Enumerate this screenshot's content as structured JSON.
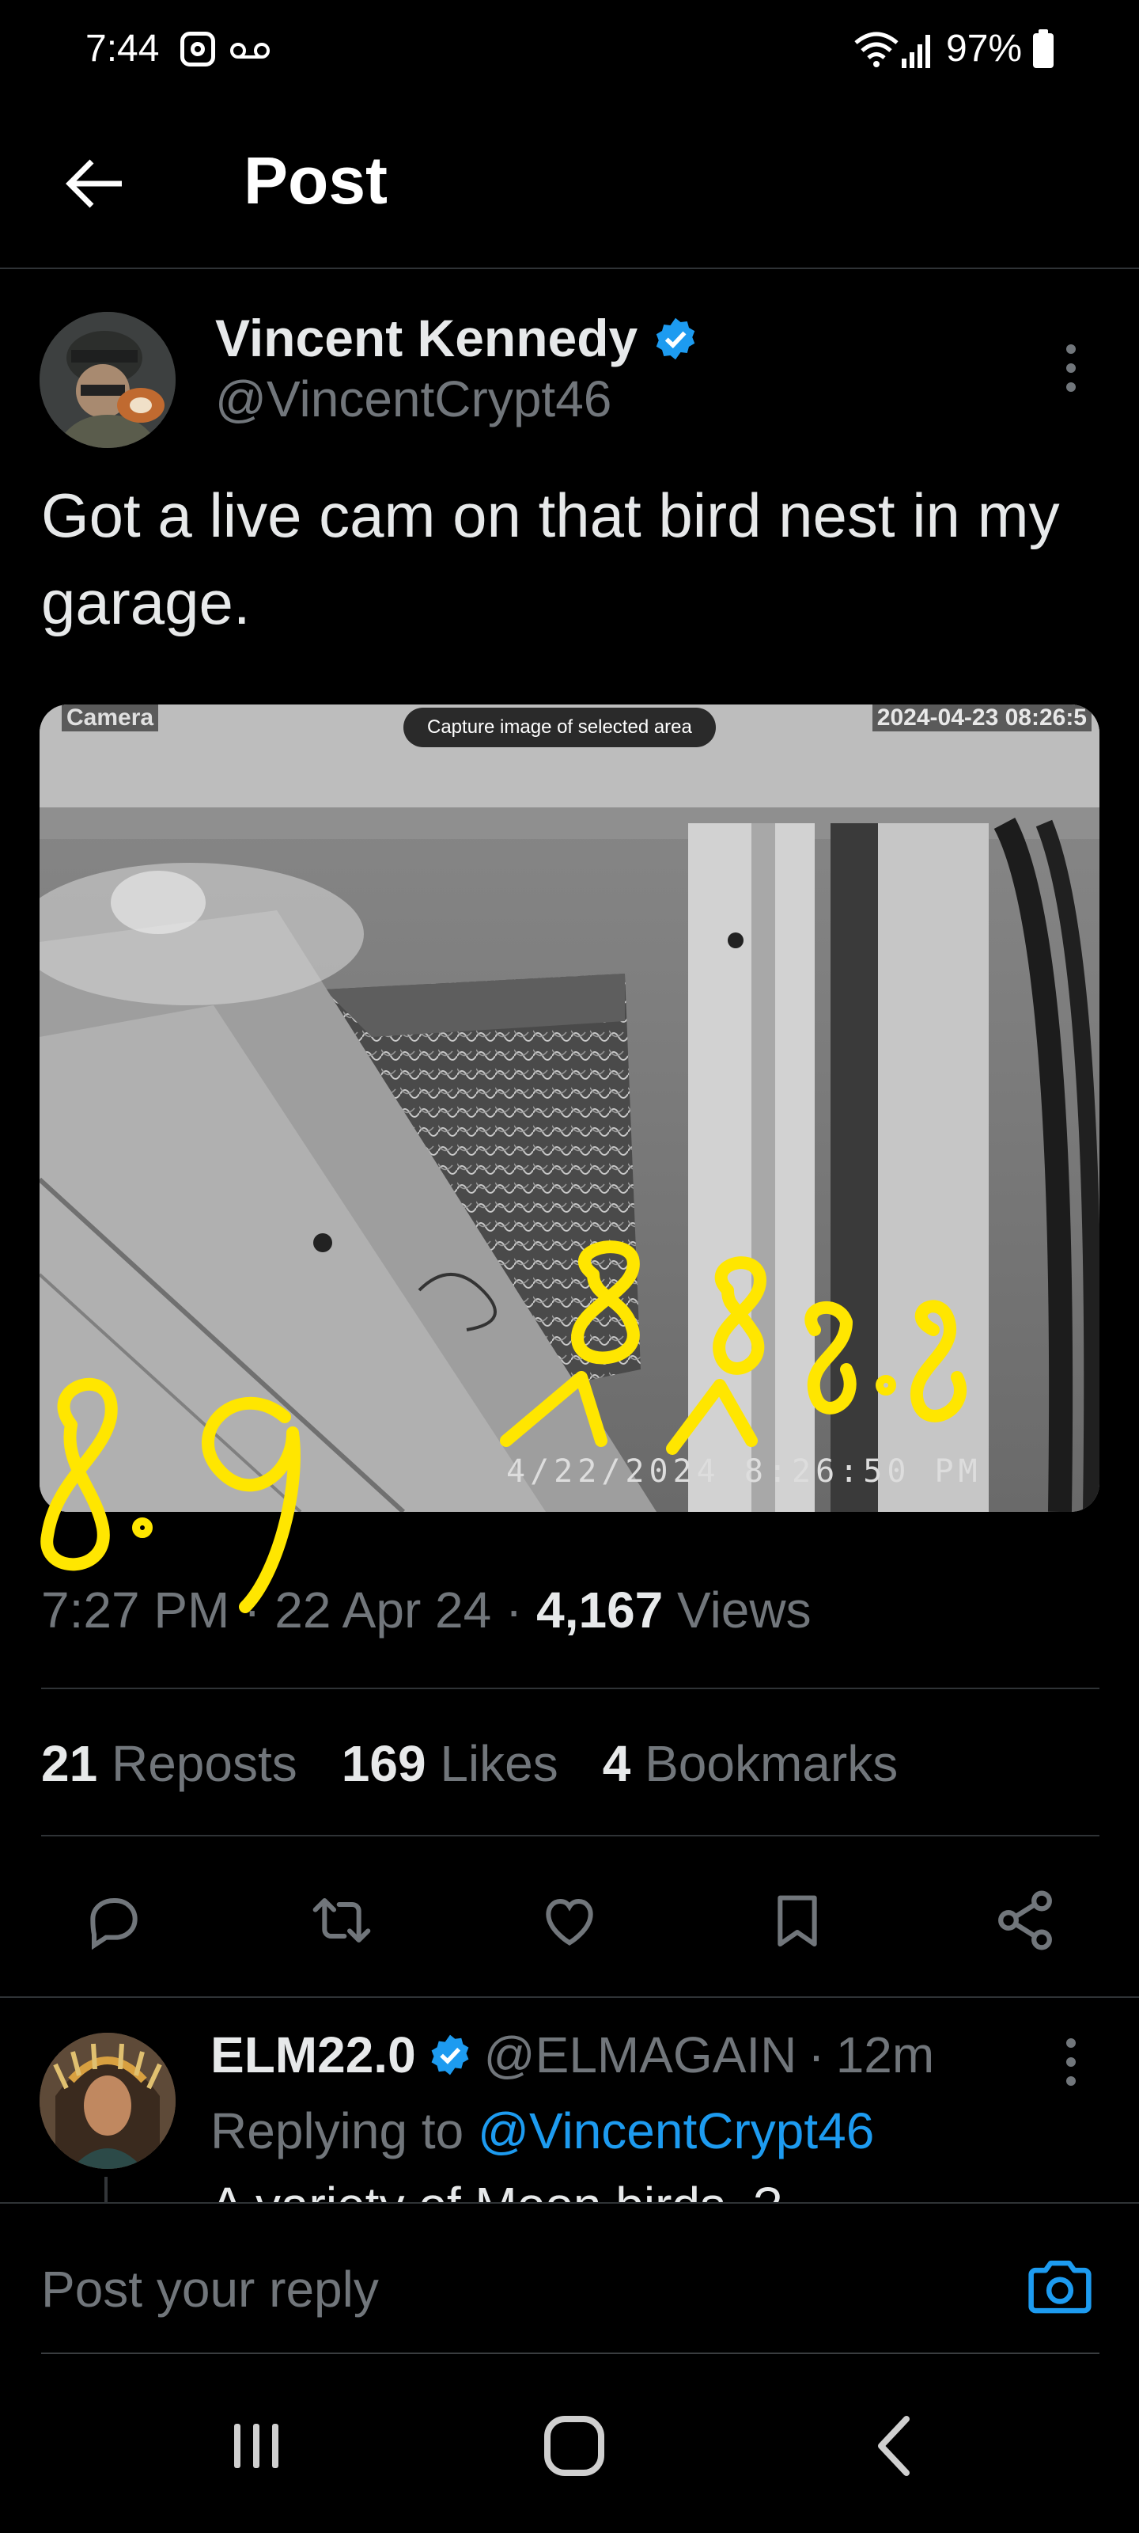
{
  "status_bar": {
    "time": "7:44",
    "battery": "97%",
    "icons": [
      "instagram-icon",
      "voicemail-icon",
      "wifi-icon",
      "signal-icon",
      "battery-icon"
    ]
  },
  "header": {
    "title": "Post",
    "back_icon": "arrow-left-icon"
  },
  "post": {
    "author_name": "Vincent Kennedy",
    "author_handle": "@VincentCrypt46",
    "verified": true,
    "text": "Got a live cam on that bird nest in my garage.",
    "media": {
      "overlay_label": "Camera",
      "capture_button": "Capture image of selected area",
      "timestamp_top": "2024-04-23 08:26:5",
      "timestamp_bottom": "4/22/2024  8:26:50 PM"
    },
    "time": "7:27 PM",
    "date": "22 Apr 24",
    "views_count": "4,167",
    "views_label": "Views",
    "separator": "·",
    "stats": {
      "reposts_count": "21",
      "reposts_label": "Reposts",
      "likes_count": "169",
      "likes_label": "Likes",
      "bookmarks_count": "4",
      "bookmarks_label": "Bookmarks"
    },
    "actions": [
      "reply-icon",
      "repost-icon",
      "like-icon",
      "bookmark-icon",
      "share-icon"
    ]
  },
  "reply": {
    "author_name": "ELM22.0",
    "author_handle": "@ELMAGAIN",
    "time": "12m",
    "verified": true,
    "replying_prefix": "Replying to",
    "replying_to": "@VincentCrypt46",
    "body_partial": "A variety of Moon birds..?"
  },
  "composer": {
    "placeholder": "Post your reply",
    "camera_icon": "camera-icon"
  },
  "nav_bar": {
    "buttons": [
      "recents-icon",
      "home-icon",
      "back-icon"
    ]
  },
  "colors": {
    "background": "#000000",
    "text_primary": "#e7e9ea",
    "text_secondary": "#71767b",
    "accent": "#1d9bf0",
    "divider": "#2f3336",
    "scribble": "#ffe600"
  }
}
